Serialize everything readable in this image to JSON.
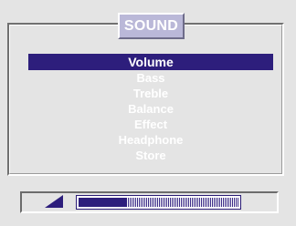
{
  "menu": {
    "title": "SOUND",
    "items": [
      {
        "label": "Volume",
        "selected": true
      },
      {
        "label": "Bass",
        "selected": false
      },
      {
        "label": "Treble",
        "selected": false
      },
      {
        "label": "Balance",
        "selected": false
      },
      {
        "label": "Effect",
        "selected": false
      },
      {
        "label": "Headphone",
        "selected": false
      },
      {
        "label": "Store",
        "selected": false
      }
    ]
  },
  "level": {
    "icon": "volume-icon",
    "value_fraction": 0.3
  },
  "colors": {
    "background": "#e4e4e4",
    "title_tab": "#bab8d8",
    "selection": "#2d1e7c",
    "bar": "#2d1e7c",
    "text": "#ffffff"
  }
}
